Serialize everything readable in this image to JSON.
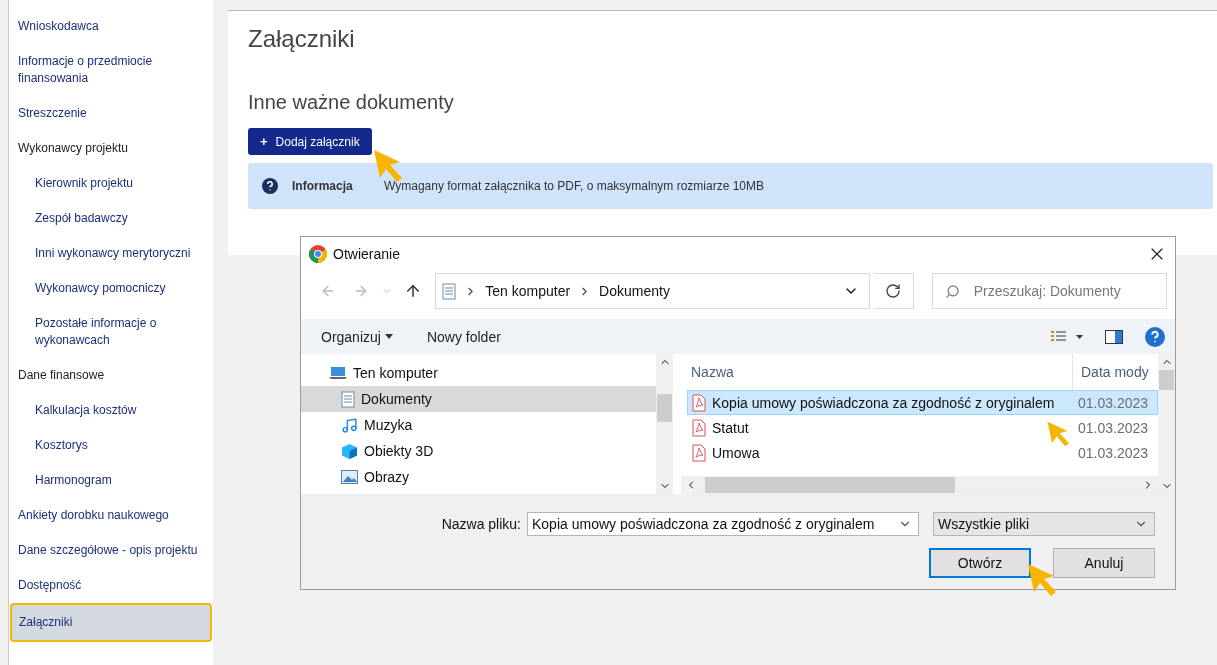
{
  "sidebar": {
    "items": [
      {
        "label": "Wnioskodawca",
        "kind": "link",
        "selected": false
      },
      {
        "label": "Informacje o przedmiocie finansowania",
        "kind": "link",
        "selected": false
      },
      {
        "label": "Streszczenie",
        "kind": "link",
        "selected": false
      },
      {
        "label": "Wykonawcy projektu",
        "kind": "group",
        "selected": false,
        "children": [
          {
            "label": "Kierownik projektu",
            "kind": "link",
            "selected": false
          },
          {
            "label": "Zespół badawczy",
            "kind": "link",
            "selected": false
          },
          {
            "label": "Inni wykonawcy merytoryczni",
            "kind": "link",
            "selected": false
          },
          {
            "label": "Wykonawcy pomocniczy",
            "kind": "link",
            "selected": false
          },
          {
            "label": "Pozostałe informacje o wykonawcach",
            "kind": "link",
            "selected": false
          }
        ]
      },
      {
        "label": "Dane finansowe",
        "kind": "group",
        "selected": false,
        "children": [
          {
            "label": "Kalkulacja kosztów",
            "kind": "link",
            "selected": false
          },
          {
            "label": "Kosztorys",
            "kind": "link",
            "selected": false
          },
          {
            "label": "Harmonogram",
            "kind": "link",
            "selected": false
          }
        ]
      },
      {
        "label": "Ankiety dorobku naukowego",
        "kind": "link",
        "selected": false
      },
      {
        "label": "Dane szczegółowe - opis projektu",
        "kind": "link",
        "selected": false
      },
      {
        "label": "Dostępność",
        "kind": "link",
        "selected": false
      },
      {
        "label": "Załączniki",
        "kind": "link",
        "selected": true
      }
    ]
  },
  "page": {
    "title": "Załączniki",
    "section_title": "Inne ważne dokumenty",
    "add_button": {
      "icon": "+",
      "label": "Dodaj załącznik"
    },
    "info": {
      "label": "Informacja",
      "text": "Wymagany format załącznika to PDF, o maksymalnym rozmiarze 10MB"
    }
  },
  "dialog": {
    "title": "Otwieranie",
    "breadcrumb": [
      "Ten komputer",
      "Dokumenty"
    ],
    "search": {
      "placeholder": "Przeszukaj: Dokumenty"
    },
    "toolbar": {
      "organize": "Organizuj",
      "new_folder": "Nowy folder"
    },
    "tree": [
      {
        "label": "Ten komputer",
        "kind": "computer",
        "selected": false
      },
      {
        "label": "Dokumenty",
        "kind": "documents",
        "selected": true
      },
      {
        "label": "Muzyka",
        "kind": "music",
        "selected": false
      },
      {
        "label": "Obiekty 3D",
        "kind": "objects",
        "selected": false
      },
      {
        "label": "Obrazy",
        "kind": "pictures",
        "selected": false
      }
    ],
    "columns": [
      "Nazwa",
      "Data mody"
    ],
    "files": [
      {
        "name": "Kopia umowy poświadczona za zgodność z oryginalem",
        "date": "01.03.2023",
        "selected": true
      },
      {
        "name": "Statut",
        "date": "01.03.2023",
        "selected": false
      },
      {
        "name": "Umowa",
        "date": "01.03.2023",
        "selected": false
      }
    ],
    "filename": {
      "label": "Nazwa pliku:",
      "value": "Kopia umowy poświadczona za zgodność z oryginalem"
    },
    "filter": "Wszystkie pliki",
    "buttons": [
      {
        "label": "Otwórz",
        "kind": "primary"
      },
      {
        "label": "Anuluj",
        "kind": "secondary"
      }
    ]
  }
}
